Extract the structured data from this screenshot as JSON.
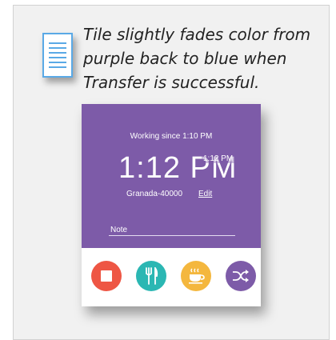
{
  "note": {
    "caption": "Tile slightly fades color from purple back to blue when Transfer is successful."
  },
  "tile": {
    "working_since": "Working since 1:10 PM",
    "time": "1:12 PM",
    "time_small": "1:12 PM",
    "location": "Granada-40000",
    "edit_label": "Edit",
    "note_placeholder": "Note",
    "colors": {
      "tile_bg": "#7d5ba8",
      "stop": "#ee5644",
      "meal": "#2bb7b3",
      "break": "#f4b73e",
      "transfer": "#7d5ba8"
    },
    "buttons": [
      {
        "icon": "stop-icon"
      },
      {
        "icon": "fork-knife-icon"
      },
      {
        "icon": "coffee-cup-icon"
      },
      {
        "icon": "shuffle-icon"
      }
    ]
  }
}
